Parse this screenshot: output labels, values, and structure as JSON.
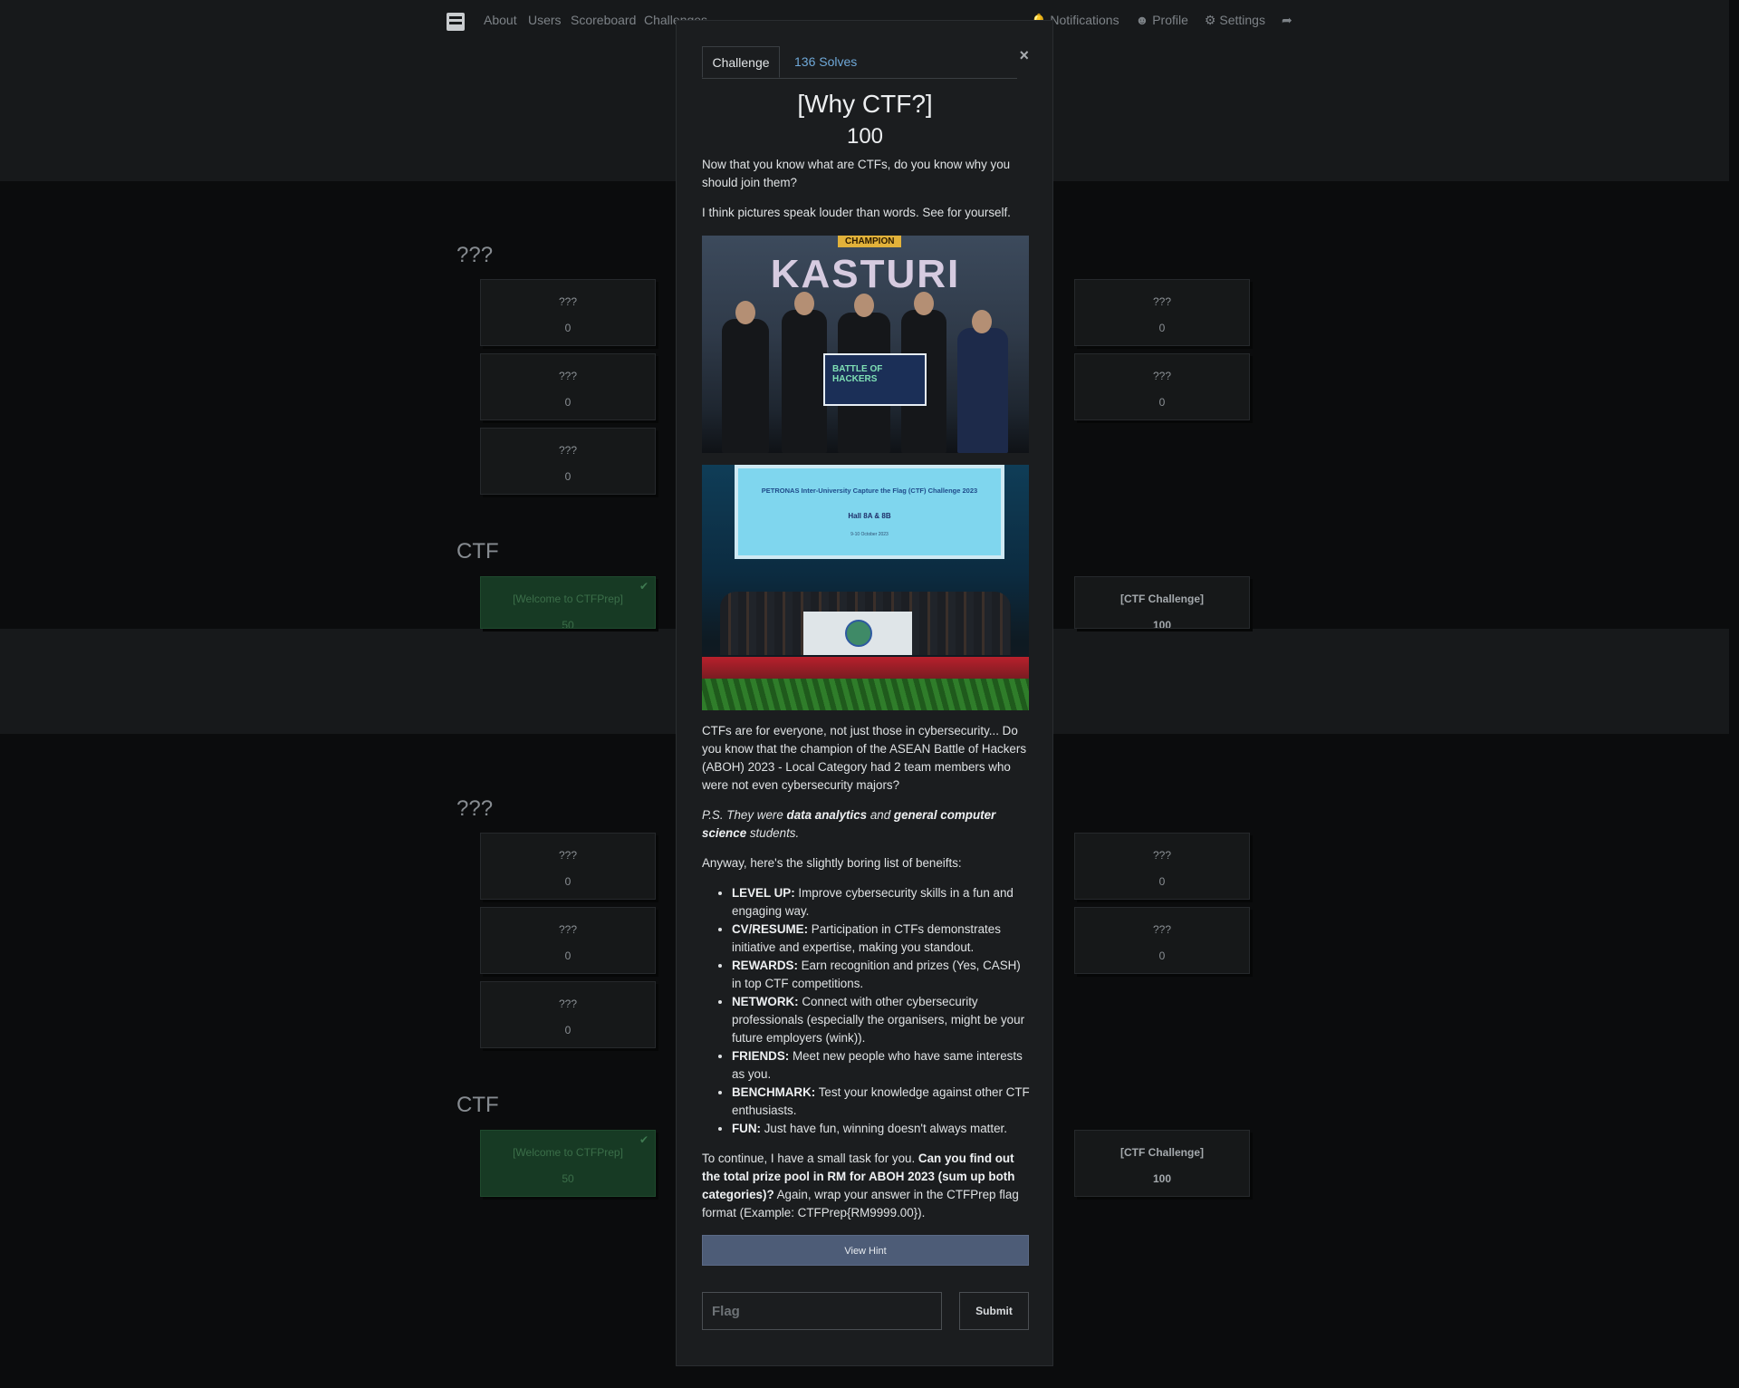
{
  "navbar": {
    "links": [
      "About",
      "Users",
      "Scoreboard",
      "Challenges"
    ],
    "right": {
      "notifications": "Notifications",
      "profile": "Profile",
      "settings": "Settings"
    }
  },
  "background": {
    "unknown_category": "???",
    "ctf_category": "CTF",
    "unknown_card": {
      "name": "???",
      "value": "0"
    },
    "welcome_card": {
      "name": "[Welcome to CTFPrep]",
      "value": "50"
    },
    "ctf_card": {
      "name": "[CTF Challenge]",
      "value": "100"
    }
  },
  "modal": {
    "tabs": {
      "challenge": "Challenge",
      "solves": "136 Solves"
    },
    "close": "×",
    "title": "[Why CTF?]",
    "value": "100",
    "intro1": "Now that you know what are CTFs, do you know why you should join them?",
    "intro2": "I think pictures speak louder than words. See for yourself.",
    "photo1": {
      "badge": "CHAMPION",
      "headline": "KASTURI",
      "cheque_text": "BATTLE OF HACKERS"
    },
    "photo2": {
      "screen_line1": "PETRONAS Inter-University Capture the Flag (CTF) Challenge 2023",
      "screen_line2": "Hall 8A & 8B",
      "screen_line3": "9-10 October 2023"
    },
    "para1": "CTFs are for everyone, not just those in cybersecurity... Do you know that the champion of the ASEAN Battle of Hackers (ABOH) 2023 - Local Category had 2 team members who were not even cybersecurity majors?",
    "ps": {
      "prefix": "P.S. They were ",
      "bold1": "data analytics",
      "mid": " and ",
      "bold2": "general computer science",
      "suffix": " students."
    },
    "list_intro": "Anyway, here's the slightly boring list of beneifts:",
    "benefits": [
      {
        "key": "LEVEL UP:",
        "text": " Improve cybersecurity skills in a fun and engaging way."
      },
      {
        "key": "CV/RESUME:",
        "text": " Participation in CTFs demonstrates initiative and expertise, making you standout."
      },
      {
        "key": "REWARDS:",
        "text": " Earn recognition and prizes (Yes, CASH) in top CTF competitions."
      },
      {
        "key": "NETWORK:",
        "text": " Connect with other cybersecurity professionals (especially the organisers, might be your future employers (wink))."
      },
      {
        "key": "FRIENDS:",
        "text": " Meet new people who have same interests as you."
      },
      {
        "key": "BENCHMARK:",
        "text": " Test your knowledge against other CTF enthusiasts."
      },
      {
        "key": "FUN:",
        "text": " Just have fun, winning doesn't always matter."
      }
    ],
    "task": {
      "prefix": "To continue, I have a small task for you. ",
      "bold": "Can you find out the total prize pool in RM for ABOH 2023 (sum up both categories)?",
      "suffix": " Again, wrap your answer in the CTFPrep flag format (Example: CTFPrep{RM9999.00})."
    },
    "hint_button": "View Hint",
    "flag_placeholder": "Flag",
    "submit_button": "Submit"
  }
}
